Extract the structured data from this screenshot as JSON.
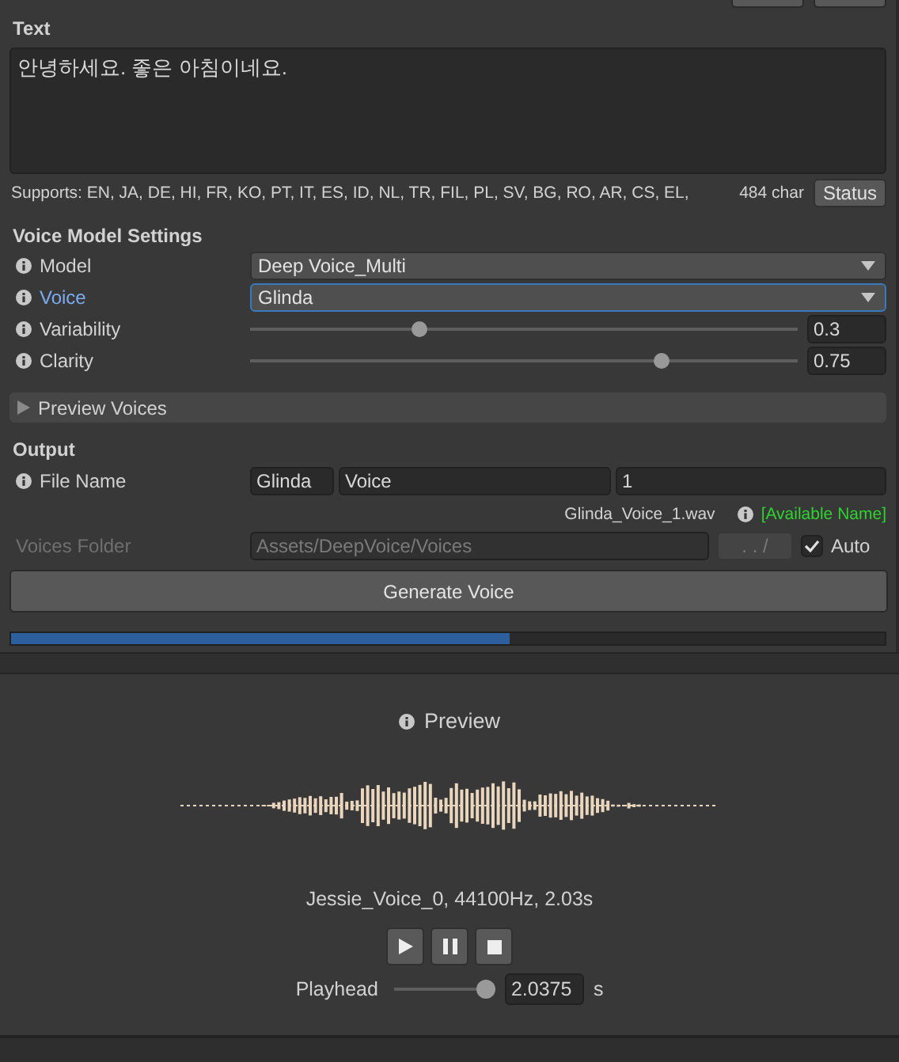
{
  "text_section": {
    "title": "Text",
    "value": "안녕하세요. 좋은 아침이네요.",
    "supports": "Supports: EN, JA, DE, HI, FR, KO, PT, IT, ES, ID, NL, TR, FIL, PL, SV, BG, RO, AR, CS, EL,",
    "char_count": "484 char",
    "status_button": "Status"
  },
  "voice_model_settings": {
    "title": "Voice Model Settings",
    "rows": [
      {
        "kind": "dropdown",
        "label": "Model",
        "value": "Deep Voice_Multi",
        "focused": false
      },
      {
        "kind": "dropdown",
        "label": "Voice",
        "value": "Glinda",
        "focused": true
      },
      {
        "kind": "slider",
        "label": "Variability",
        "level": 0.31,
        "value": "0.3"
      },
      {
        "kind": "slider",
        "label": "Clarity",
        "level": 0.75,
        "value": "0.75"
      }
    ]
  },
  "preview_voices": {
    "label": "Preview Voices",
    "expanded": false
  },
  "output": {
    "title": "Output",
    "file_name": {
      "label": "File Name",
      "parts": [
        "Glinda",
        "Voice",
        "1"
      ]
    },
    "result_file": "Glinda_Voice_1.wav",
    "availability": "[Available Name]",
    "voices_folder": {
      "label": "Voices Folder",
      "value": "Assets/DeepVoice/Voices",
      "disabled": true,
      "browse_button": ". . /",
      "auto_label": "Auto",
      "auto_checked": true
    },
    "generate_button": "Generate Voice",
    "progress": {
      "level": 0.57
    }
  },
  "preview": {
    "title": "Preview",
    "clip_info": "Jessie_Voice_0, 44100Hz, 2.03s",
    "controls": [
      {
        "kind": "play"
      },
      {
        "kind": "pause"
      },
      {
        "kind": "stop"
      }
    ],
    "playhead": {
      "label": "Playhead",
      "level": 0.97,
      "value": "2.0375",
      "unit": "s"
    }
  }
}
